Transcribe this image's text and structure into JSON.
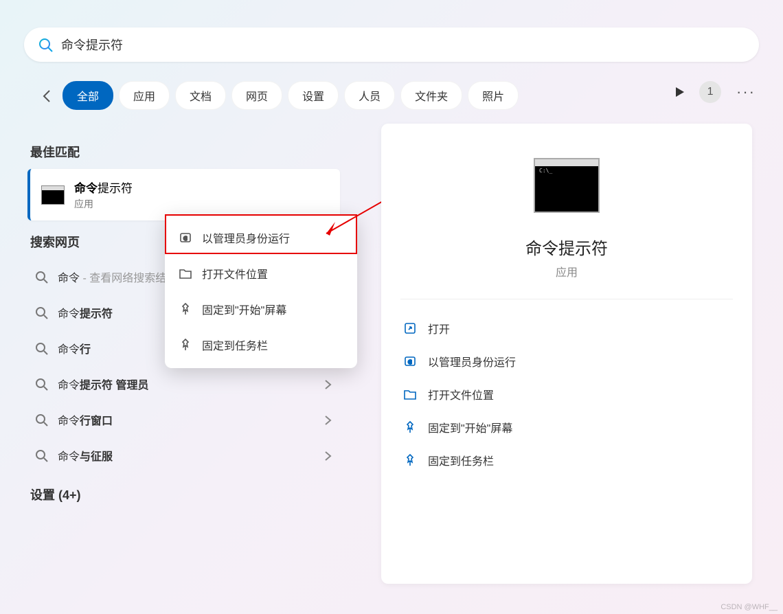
{
  "search": {
    "query": "命令",
    "suffix": "提示符"
  },
  "filters": {
    "items": [
      "全部",
      "应用",
      "文档",
      "网页",
      "设置",
      "人员",
      "文件夹",
      "照片"
    ],
    "active": 0
  },
  "badge": "1",
  "left": {
    "best_match_header": "最佳匹配",
    "best_match": {
      "title_bold": "命令",
      "title_rest": "提示符",
      "sub": "应用"
    },
    "web_header": "搜索网页",
    "web_items": [
      {
        "prefix": "命令",
        "suffix": "",
        "hint": " - 查看网络搜索结果",
        "has_chev": false
      },
      {
        "prefix": "命令",
        "suffix": "提示符",
        "hint": "",
        "has_chev": true
      },
      {
        "prefix": "命令",
        "suffix": "行",
        "hint": "",
        "has_chev": true
      },
      {
        "prefix": "命令",
        "suffix": "提示符 管理员",
        "hint": "",
        "has_chev": true
      },
      {
        "prefix": "命令",
        "suffix": "行窗口",
        "hint": "",
        "has_chev": true
      },
      {
        "prefix": "命令",
        "suffix": "与征服",
        "hint": "",
        "has_chev": true
      }
    ],
    "settings_header": "设置 (4+)"
  },
  "context_menu": [
    {
      "icon": "admin",
      "label": "以管理员身份运行"
    },
    {
      "icon": "folder",
      "label": "打开文件位置"
    },
    {
      "icon": "pin",
      "label": "固定到\"开始\"屏幕"
    },
    {
      "icon": "pin",
      "label": "固定到任务栏"
    }
  ],
  "preview": {
    "title": "命令提示符",
    "sub": "应用",
    "actions": [
      {
        "icon": "open",
        "label": "打开"
      },
      {
        "icon": "admin",
        "label": "以管理员身份运行"
      },
      {
        "icon": "folder",
        "label": "打开文件位置"
      },
      {
        "icon": "pin",
        "label": "固定到\"开始\"屏幕"
      },
      {
        "icon": "pin",
        "label": "固定到任务栏"
      }
    ]
  },
  "watermark": "CSDN @WHF__"
}
